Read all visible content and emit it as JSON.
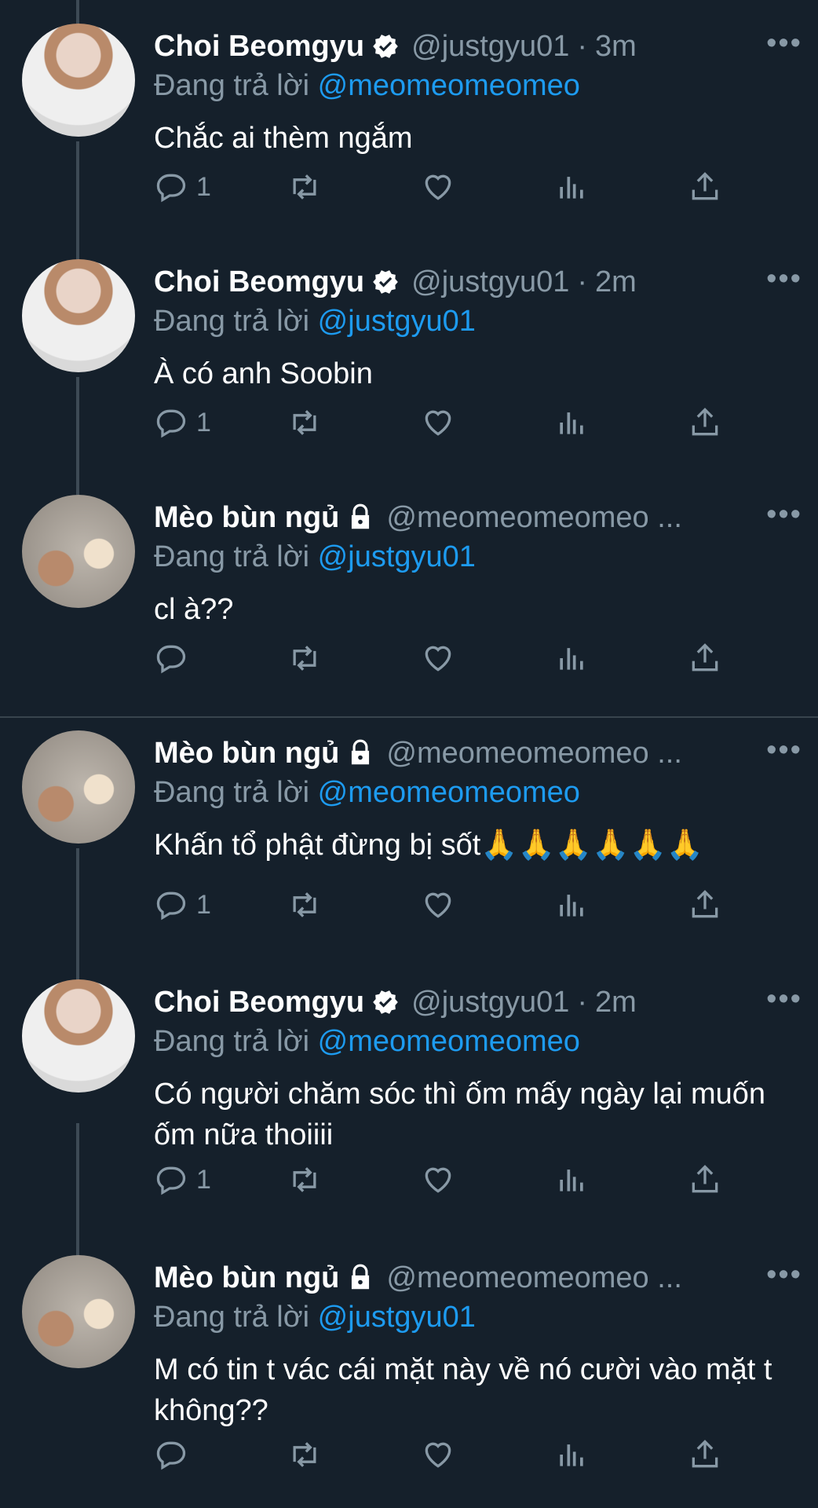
{
  "tweets": [
    {
      "name": "Choi Beomgyu",
      "badge": "verified",
      "handle": "@justgyu01",
      "time": "3m",
      "reply_prefix": "Đang trả lời",
      "reply_to": "@meomeomeomeo",
      "text": "Chắc ai thèm ngắm",
      "reply_count": "1"
    },
    {
      "name": "Choi Beomgyu",
      "badge": "verified",
      "handle": "@justgyu01",
      "time": "2m",
      "reply_prefix": "Đang trả lời",
      "reply_to": "@justgyu01",
      "text": "À có anh Soobin",
      "reply_count": "1"
    },
    {
      "name": "Mèo bùn ngủ",
      "badge": "protected",
      "handle": "@meomeomeomeo ...",
      "time": "",
      "reply_prefix": "Đang trả lời",
      "reply_to": "@justgyu01",
      "text": "cl à??",
      "reply_count": ""
    },
    {
      "name": "Mèo bùn ngủ",
      "badge": "protected",
      "handle": "@meomeomeomeo ...",
      "time": "",
      "reply_prefix": "Đang trả lời",
      "reply_to": "@meomeomeomeo",
      "text": "Khấn tổ phật đừng bị sốt🙏🙏🙏🙏🙏🙏",
      "reply_count": "1"
    },
    {
      "name": "Choi Beomgyu",
      "badge": "verified",
      "handle": "@justgyu01",
      "time": "2m",
      "reply_prefix": "Đang trả lời",
      "reply_to": "@meomeomeomeo",
      "text": "Có người chăm sóc thì ốm mấy ngày lại muốn ốm nữa thoiiii",
      "reply_count": "1"
    },
    {
      "name": "Mèo bùn ngủ",
      "badge": "protected",
      "handle": "@meomeomeomeo ...",
      "time": "",
      "reply_prefix": "Đang trả lời",
      "reply_to": "@justgyu01",
      "text": "M có tin t vác cái mặt này về nó cười vào mặt t không??",
      "reply_count": ""
    }
  ],
  "icons": {
    "more": "more-dots-icon",
    "reply": "reply-icon",
    "retweet": "retweet-icon",
    "like": "heart-icon",
    "analytics": "analytics-icon",
    "share": "share-icon",
    "verified": "verified-badge-icon",
    "protected": "lock-icon"
  },
  "colors": {
    "background": "#15202b",
    "link": "#1d9bf0",
    "secondary_text": "#8899a6"
  }
}
